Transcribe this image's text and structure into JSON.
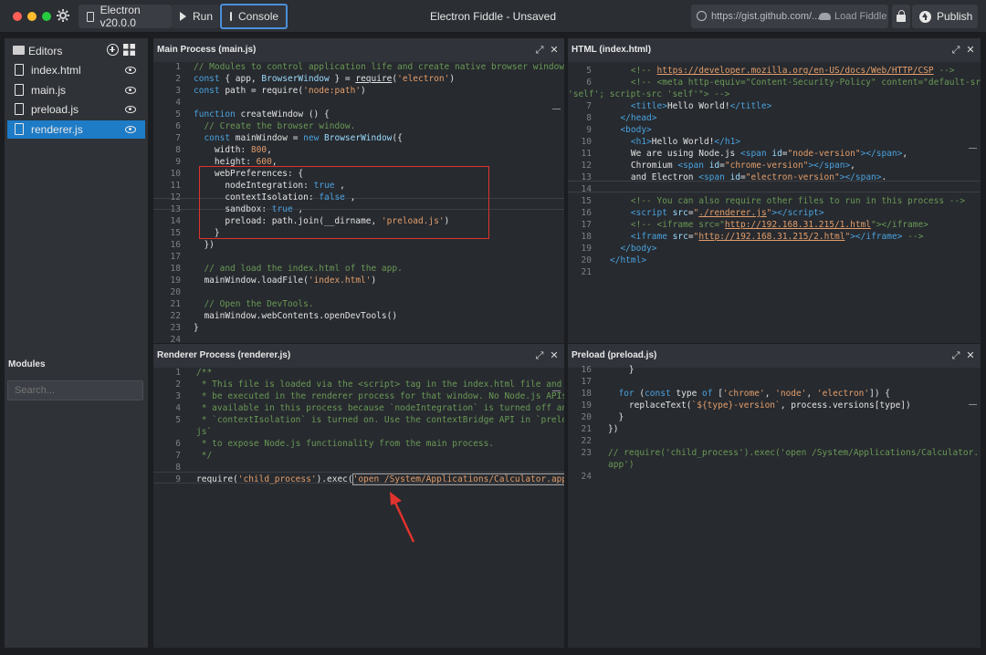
{
  "titlebar": {
    "version_label": "Electron v20.0.0",
    "run_label": "Run",
    "console_label": "Console",
    "window_title": "Electron Fiddle - Unsaved",
    "gist_placeholder": "https://gist.github.com/...",
    "load_fiddle_label": "Load Fiddle",
    "publish_label": "Publish"
  },
  "sidebar": {
    "editors_title": "Editors",
    "files": [
      {
        "label": "index.html"
      },
      {
        "label": "main.js"
      },
      {
        "label": "preload.js"
      },
      {
        "label": "renderer.js"
      }
    ],
    "modules_title": "Modules",
    "search_placeholder": "Search..."
  },
  "panes": {
    "main": {
      "title": "Main Process (main.js)"
    },
    "html": {
      "title": "HTML (index.html)"
    },
    "renderer": {
      "title": "Renderer Process (renderer.js)"
    },
    "preload": {
      "title": "Preload (preload.js)"
    }
  },
  "colors": {
    "accent": "#1e7bc6",
    "console_border": "#4a90d9",
    "annotation_red": "#e0332e"
  }
}
